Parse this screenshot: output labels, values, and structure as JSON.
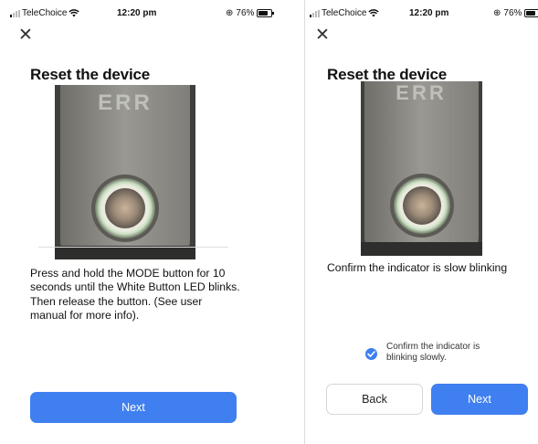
{
  "left_screen": {
    "status_bar": {
      "carrier": "TeleChoice",
      "time": "12:20 pm",
      "battery": "76%"
    },
    "title": "Reset the device",
    "image_text": "ERR",
    "instruction": "Press and hold the MODE button for 10 seconds until the White Button LED blinks. Then release the button. (See user manual for more info).",
    "next_label": "Next"
  },
  "right_screen": {
    "status_bar": {
      "carrier": "TeleChoice",
      "time": "12:20 pm",
      "battery": "76%"
    },
    "title": "Reset the device",
    "image_text": "ERR",
    "instruction": "Confirm the indicator is slow blinking",
    "checkbox_label": "Confirm the indicator is blinking slowly.",
    "checkbox_checked": true,
    "back_label": "Back",
    "next_label": "Next"
  },
  "colors": {
    "primary": "#3f7ff0",
    "text": "#111111",
    "panel": "#8f8d87",
    "led_ring": "#e8f0e0"
  },
  "icons": [
    "signal-icon",
    "wifi-icon",
    "rotation-lock-icon",
    "battery-icon",
    "close-icon",
    "check-icon"
  ]
}
